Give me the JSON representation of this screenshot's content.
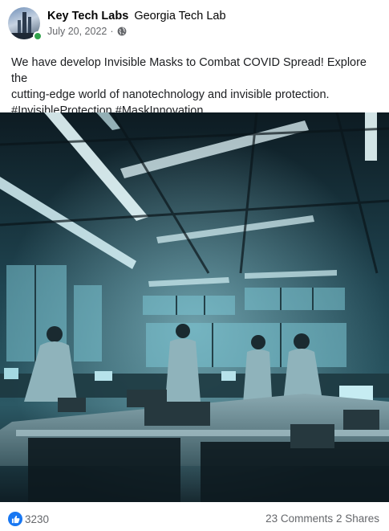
{
  "post": {
    "author": "Key Tech Labs",
    "group": "Georgia Tech Lab",
    "date": "July 20, 2022",
    "separator": "·",
    "audience_icon": "globe-icon",
    "text_line1": "We have develop Invisible Masks to Combat COVID Spread! Explore the",
    "text_line2": "cutting-edge world of nanotechnology and invisible protection.",
    "text_line3": "#InvisibleProtection #MaskInnovation"
  },
  "stats": {
    "reaction_icon": "like-icon",
    "reaction_count": "3230",
    "comments": "23 Comments",
    "shares": "2 Shares"
  },
  "colors": {
    "accent": "#1877f2",
    "online": "#31a24c",
    "meta_text": "#65676b"
  }
}
